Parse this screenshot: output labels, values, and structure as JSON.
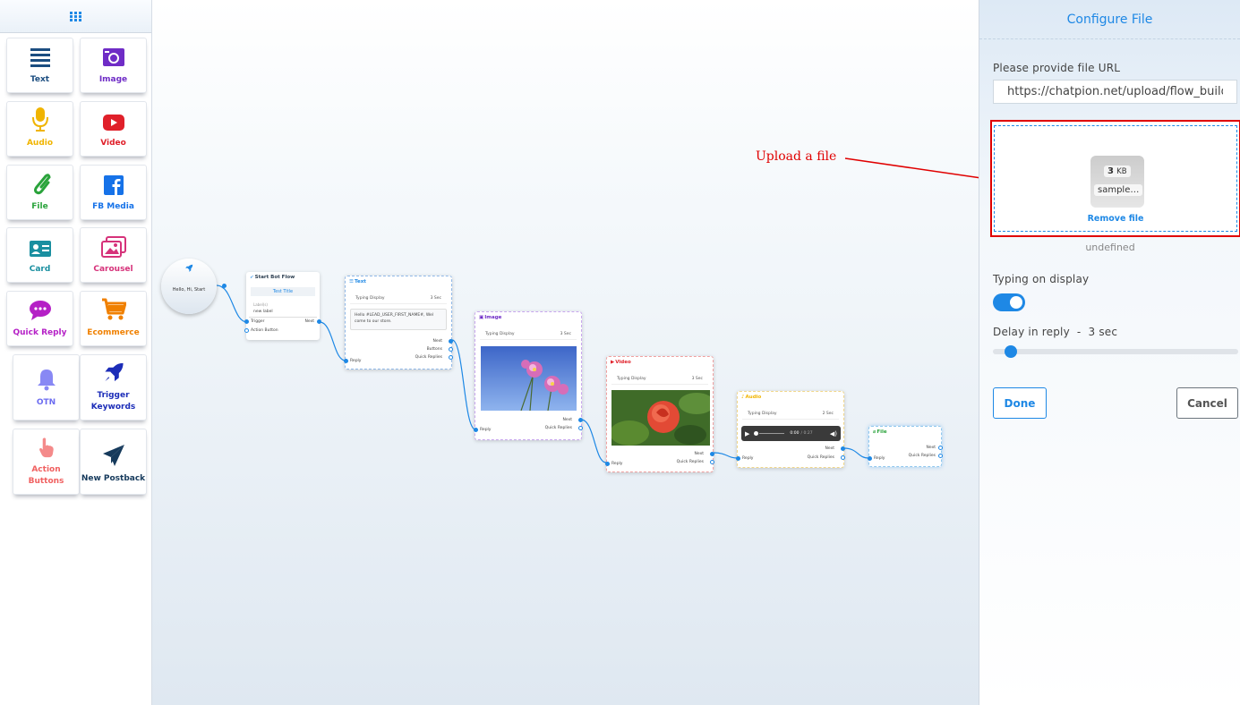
{
  "sidebar": {
    "items": [
      {
        "label": "Text",
        "color": "#1b4d80"
      },
      {
        "label": "Image",
        "color": "#6f2cc6"
      },
      {
        "label": "Audio",
        "color": "#f0b400"
      },
      {
        "label": "Video",
        "color": "#e0202a"
      },
      {
        "label": "File",
        "color": "#2aa33b"
      },
      {
        "label": "FB Media",
        "color": "#1672e8"
      },
      {
        "label": "Card",
        "color": "#1a8fa0"
      },
      {
        "label": "Carousel",
        "color": "#d6327a"
      },
      {
        "label": "Quick Reply",
        "color": "#b520c6"
      },
      {
        "label": "Ecommerce",
        "color": "#f08000"
      },
      {
        "label": "OTN",
        "color": "#6c6cf0"
      },
      {
        "label": "Trigger\nKeywords",
        "color": "#1c2db8"
      },
      {
        "label": "Action\nButtons",
        "color": "#f06060"
      },
      {
        "label": "New Postback",
        "color": "#163a5c"
      }
    ]
  },
  "canvas": {
    "start": {
      "label": "Hello, Hi, Start"
    },
    "start_flow": {
      "title": "Start Bot Flow",
      "test_title": "Test Title",
      "sublabel": "Label(s)",
      "label_value": "new label",
      "trigger": "Trigger",
      "next": "Next",
      "action_button": "Action Button"
    },
    "text_node": {
      "title": "Text",
      "typing": "Typing Display",
      "sec": "3 Sec",
      "message": "Hello #LEAD_USER_FIRST_NAME#, Wel come to our store.",
      "reply": "Reply",
      "next": "Next",
      "buttons": "Buttons",
      "quick": "Quick Replies"
    },
    "image_node": {
      "title": "Image",
      "typing": "Typing Display",
      "sec": "3 Sec",
      "reply": "Reply",
      "next": "Next",
      "quick": "Quick Replies"
    },
    "video_node": {
      "title": "Video",
      "typing": "Typing Display",
      "sec": "3 Sec",
      "reply": "Reply",
      "next": "Next",
      "quick": "Quick Replies"
    },
    "audio_node": {
      "title": "Audio",
      "typing": "Typing Display",
      "sec": "2 Sec",
      "time": "0:00",
      "duration": "/ 0:27",
      "reply": "Reply",
      "next": "Next",
      "quick": "Quick Replies"
    },
    "file_node": {
      "title": "File",
      "reply": "Reply",
      "next": "Next",
      "quick": "Quick Replies"
    }
  },
  "annotation": {
    "text": "Upload a file",
    "color": "#e00000"
  },
  "panel": {
    "title": "Configure File",
    "url_label": "Please provide file URL",
    "url_value": "https://chatpion.net/upload/flow_builder/sample.pdf",
    "file_size_num": "3",
    "file_size_unit": "KB",
    "file_name": "sample…",
    "remove_label": "Remove file",
    "undefined_text": "undefined",
    "typing_label": "Typing on display",
    "typing_on": true,
    "delay_label": "Delay in reply  -  3 sec",
    "delay_value": 3,
    "done_label": "Done",
    "cancel_label": "Cancel",
    "accent": "#1e88e5"
  }
}
